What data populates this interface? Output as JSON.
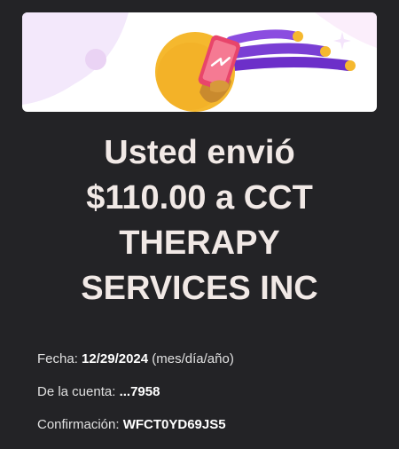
{
  "banner": {
    "illustration": "phone-sending-money-illustration",
    "colors": {
      "coin": "#f5b82e",
      "swoosh": "#7a3fd4",
      "phone": "#e8456b",
      "background_blob": "#f3e8fb"
    }
  },
  "headline": {
    "lines": [
      "Usted envió",
      "$110.00 a CCT",
      "THERAPY",
      "SERVICES INC"
    ]
  },
  "details": {
    "date": {
      "label": "Fecha:",
      "value": "12/29/2024",
      "suffix": "(mes/día/año)"
    },
    "account": {
      "label": "De la cuenta:",
      "value": "...7958"
    },
    "confirmation": {
      "label": "Confirmación:",
      "value": "WFCT0YD69JS5"
    }
  }
}
